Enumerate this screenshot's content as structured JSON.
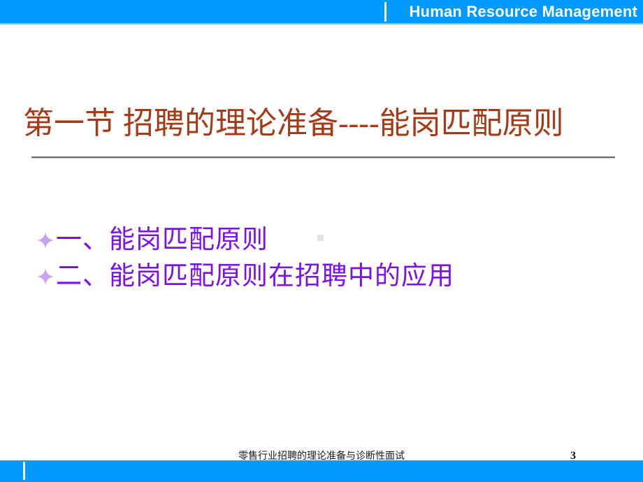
{
  "header": {
    "title": "Human Resource Management",
    "divider_icon": "vertical-divider-icon",
    "bar_color": "#0099fe",
    "text_color": "#ffffff"
  },
  "title": {
    "text": "第一节 招聘的理论准备----能岗匹配原则",
    "color": "#a63a17",
    "rule_color": "#6b6b6b"
  },
  "bullets": {
    "marker_icon": "four-point-star-bullet-icon",
    "marker_color": "#c8a2f0",
    "text_color": "#7b0ff0",
    "items": [
      {
        "label": "一、能岗匹配原则"
      },
      {
        "label": "二、能岗匹配原则在招聘中的应用"
      }
    ]
  },
  "footer": {
    "note": "零售行业招聘的理论准备与诊断性面试",
    "page_number": "3",
    "divider_icon": "vertical-divider-icon",
    "bar_color": "#0099fe"
  }
}
